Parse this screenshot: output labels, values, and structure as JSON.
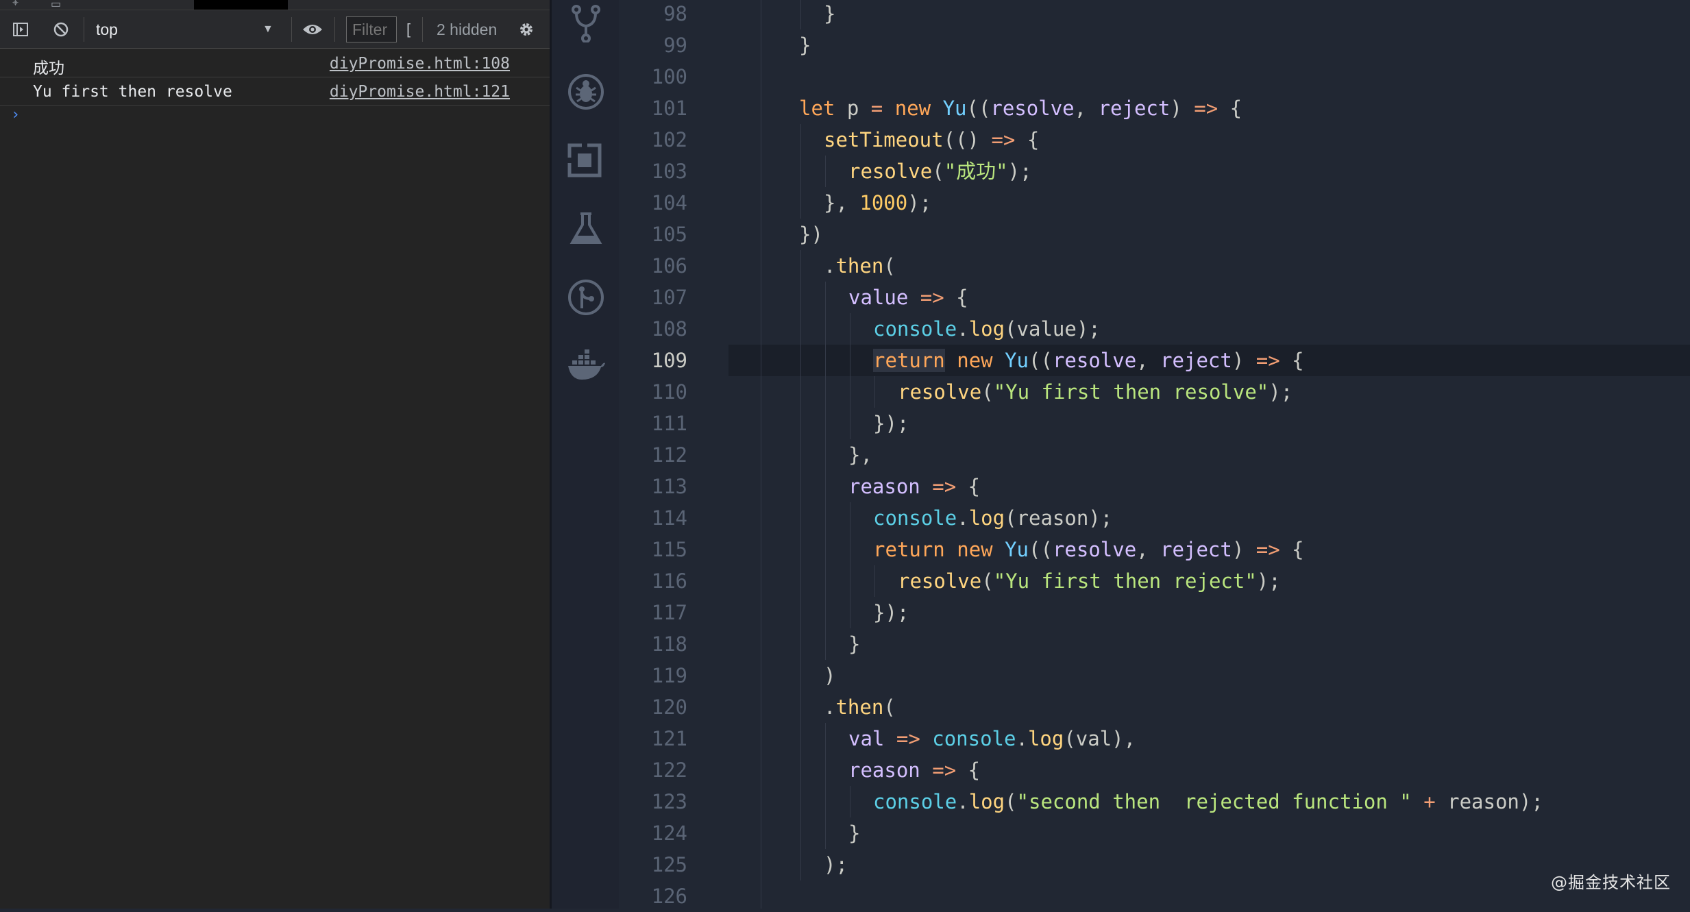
{
  "devtools": {
    "toolbar": {
      "context": "top",
      "filter_placeholder": "Filter",
      "filter_extra": "[",
      "hidden_count": "2 hidden"
    },
    "logs": [
      {
        "message": "成功",
        "source": "diyPromise.html:108"
      },
      {
        "message": "Yu first then resolve",
        "source": "diyPromise.html:121"
      }
    ],
    "prompt": "›"
  },
  "activity_bar": {
    "icons": [
      "source-control-icon",
      "debug-icon",
      "extensions-icon",
      "test-flask-icon",
      "git-graph-icon",
      "docker-icon"
    ]
  },
  "editor": {
    "active_line": 109,
    "lines": [
      {
        "no": 98,
        "indent": 1,
        "tokens": [
          [
            "pun",
            "}"
          ]
        ]
      },
      {
        "no": 99,
        "indent": 0,
        "tokens": [
          [
            "pun",
            "}"
          ]
        ]
      },
      {
        "no": 100,
        "indent": 0,
        "tokens": []
      },
      {
        "no": 101,
        "indent": 0,
        "tokens": [
          [
            "kw",
            "let"
          ],
          [
            "pun",
            " p "
          ],
          [
            "op",
            "="
          ],
          [
            "pun",
            " "
          ],
          [
            "kw",
            "new"
          ],
          [
            "pun",
            " "
          ],
          [
            "cls",
            "Yu"
          ],
          [
            "pun",
            "(("
          ],
          [
            "par",
            "resolve"
          ],
          [
            "pun",
            ", "
          ],
          [
            "par",
            "reject"
          ],
          [
            "pun",
            ") "
          ],
          [
            "op",
            "=>"
          ],
          [
            "pun",
            " {"
          ]
        ]
      },
      {
        "no": 102,
        "indent": 1,
        "tokens": [
          [
            "fn",
            "setTimeout"
          ],
          [
            "pun",
            "(() "
          ],
          [
            "op",
            "=>"
          ],
          [
            "pun",
            " {"
          ]
        ]
      },
      {
        "no": 103,
        "indent": 2,
        "tokens": [
          [
            "fn",
            "resolve"
          ],
          [
            "pun",
            "("
          ],
          [
            "str",
            "\"成功\""
          ],
          [
            "pun",
            ");"
          ]
        ]
      },
      {
        "no": 104,
        "indent": 1,
        "tokens": [
          [
            "pun",
            "}, "
          ],
          [
            "num",
            "1000"
          ],
          [
            "pun",
            ");"
          ]
        ]
      },
      {
        "no": 105,
        "indent": 0,
        "tokens": [
          [
            "pun",
            "})"
          ]
        ]
      },
      {
        "no": 106,
        "indent": 1,
        "tokens": [
          [
            "pun",
            "."
          ],
          [
            "fn",
            "then"
          ],
          [
            "pun",
            "("
          ]
        ]
      },
      {
        "no": 107,
        "indent": 2,
        "tokens": [
          [
            "par",
            "value"
          ],
          [
            "pun",
            " "
          ],
          [
            "op",
            "=>"
          ],
          [
            "pun",
            " {"
          ]
        ]
      },
      {
        "no": 108,
        "indent": 3,
        "tokens": [
          [
            "obj",
            "console"
          ],
          [
            "pun",
            "."
          ],
          [
            "fn",
            "log"
          ],
          [
            "pun",
            "(value);"
          ]
        ]
      },
      {
        "no": 109,
        "indent": 3,
        "tokens": [
          [
            "kw ret-hl",
            "return"
          ],
          [
            "pun",
            " "
          ],
          [
            "kw",
            "new"
          ],
          [
            "pun",
            " "
          ],
          [
            "cls",
            "Yu"
          ],
          [
            "pun",
            "(("
          ],
          [
            "par",
            "resolve"
          ],
          [
            "pun",
            ", "
          ],
          [
            "par",
            "reject"
          ],
          [
            "pun",
            ") "
          ],
          [
            "op",
            "=>"
          ],
          [
            "pun",
            " {"
          ]
        ]
      },
      {
        "no": 110,
        "indent": 4,
        "tokens": [
          [
            "fn",
            "resolve"
          ],
          [
            "pun",
            "("
          ],
          [
            "str",
            "\"Yu first then resolve\""
          ],
          [
            "pun",
            ");"
          ]
        ]
      },
      {
        "no": 111,
        "indent": 3,
        "tokens": [
          [
            "pun",
            "});"
          ]
        ]
      },
      {
        "no": 112,
        "indent": 2,
        "tokens": [
          [
            "pun",
            "},"
          ]
        ]
      },
      {
        "no": 113,
        "indent": 2,
        "tokens": [
          [
            "par",
            "reason"
          ],
          [
            "pun",
            " "
          ],
          [
            "op",
            "=>"
          ],
          [
            "pun",
            " {"
          ]
        ]
      },
      {
        "no": 114,
        "indent": 3,
        "tokens": [
          [
            "obj",
            "console"
          ],
          [
            "pun",
            "."
          ],
          [
            "fn",
            "log"
          ],
          [
            "pun",
            "(reason);"
          ]
        ]
      },
      {
        "no": 115,
        "indent": 3,
        "tokens": [
          [
            "kw",
            "return"
          ],
          [
            "pun",
            " "
          ],
          [
            "kw",
            "new"
          ],
          [
            "pun",
            " "
          ],
          [
            "cls",
            "Yu"
          ],
          [
            "pun",
            "(("
          ],
          [
            "par",
            "resolve"
          ],
          [
            "pun",
            ", "
          ],
          [
            "par",
            "reject"
          ],
          [
            "pun",
            ") "
          ],
          [
            "op",
            "=>"
          ],
          [
            "pun",
            " {"
          ]
        ]
      },
      {
        "no": 116,
        "indent": 4,
        "tokens": [
          [
            "fn",
            "resolve"
          ],
          [
            "pun",
            "("
          ],
          [
            "str",
            "\"Yu first then reject\""
          ],
          [
            "pun",
            ");"
          ]
        ]
      },
      {
        "no": 117,
        "indent": 3,
        "tokens": [
          [
            "pun",
            "});"
          ]
        ]
      },
      {
        "no": 118,
        "indent": 2,
        "tokens": [
          [
            "pun",
            "}"
          ]
        ]
      },
      {
        "no": 119,
        "indent": 1,
        "tokens": [
          [
            "pun",
            ")"
          ]
        ]
      },
      {
        "no": 120,
        "indent": 1,
        "tokens": [
          [
            "pun",
            "."
          ],
          [
            "fn",
            "then"
          ],
          [
            "pun",
            "("
          ]
        ]
      },
      {
        "no": 121,
        "indent": 2,
        "tokens": [
          [
            "par",
            "val"
          ],
          [
            "pun",
            " "
          ],
          [
            "op",
            "=>"
          ],
          [
            "pun",
            " "
          ],
          [
            "obj",
            "console"
          ],
          [
            "pun",
            "."
          ],
          [
            "fn",
            "log"
          ],
          [
            "pun",
            "(val),"
          ]
        ]
      },
      {
        "no": 122,
        "indent": 2,
        "tokens": [
          [
            "par",
            "reason"
          ],
          [
            "pun",
            " "
          ],
          [
            "op",
            "=>"
          ],
          [
            "pun",
            " {"
          ]
        ]
      },
      {
        "no": 123,
        "indent": 3,
        "tokens": [
          [
            "obj",
            "console"
          ],
          [
            "pun",
            "."
          ],
          [
            "fn",
            "log"
          ],
          [
            "pun",
            "("
          ],
          [
            "str",
            "\"second then  rejected function \""
          ],
          [
            "pun",
            " "
          ],
          [
            "op",
            "+"
          ],
          [
            "pun",
            " reason);"
          ]
        ]
      },
      {
        "no": 124,
        "indent": 2,
        "tokens": [
          [
            "pun",
            "}"
          ]
        ]
      },
      {
        "no": 125,
        "indent": 1,
        "tokens": [
          [
            "pun",
            ");"
          ]
        ]
      },
      {
        "no": 126,
        "indent": 0,
        "tokens": []
      }
    ]
  },
  "watermark": "@掘金技术社区"
}
